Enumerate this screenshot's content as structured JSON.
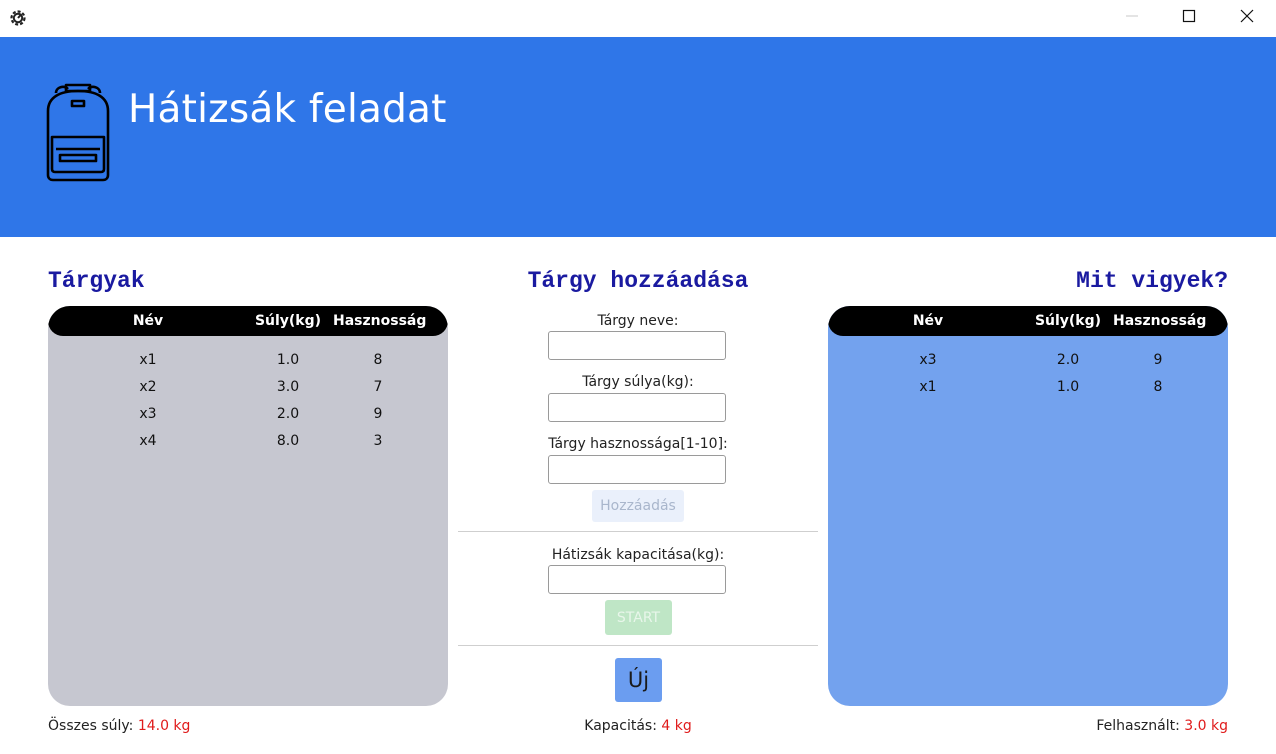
{
  "window": {
    "icons": {
      "app": "gear-icon",
      "minimize": "minimize-icon",
      "maximize": "maximize-icon",
      "close": "close-icon"
    }
  },
  "header": {
    "title": "Hátizsák feladat",
    "icon": "backpack-icon",
    "background": "#2f76e8"
  },
  "items_panel": {
    "title": "Tárgyak",
    "columns": [
      "Név",
      "Súly(kg)",
      "Hasznosság"
    ],
    "rows": [
      {
        "name": "x1",
        "weight": "1.0",
        "value": "8"
      },
      {
        "name": "x2",
        "weight": "3.0",
        "value": "7"
      },
      {
        "name": "x3",
        "weight": "2.0",
        "value": "9"
      },
      {
        "name": "x4",
        "weight": "8.0",
        "value": "3"
      }
    ],
    "background": "#c6c7d0"
  },
  "add_panel": {
    "title": "Tárgy hozzáadása",
    "name_label": "Tárgy neve:",
    "name_value": "",
    "weight_label": "Tárgy súlya(kg):",
    "weight_value": "",
    "value_label": "Tárgy hasznossága[1-10]:",
    "value_value": "",
    "add_button": "Hozzáadás",
    "capacity_label": "Hátizsák kapacitása(kg):",
    "capacity_value": "",
    "start_button": "START",
    "new_button": "Új"
  },
  "result_panel": {
    "title": "Mit vigyek?",
    "columns": [
      "Név",
      "Súly(kg)",
      "Hasznosság"
    ],
    "rows": [
      {
        "name": "x3",
        "weight": "2.0",
        "value": "9"
      },
      {
        "name": "x1",
        "weight": "1.0",
        "value": "8"
      }
    ],
    "background": "#73a2ee"
  },
  "footer": {
    "total_label": "Összes súly:",
    "total_value": "14.0 kg",
    "capacity_label": "Kapacitás:",
    "capacity_value": "4 kg",
    "used_label": "Felhasznált:",
    "used_value": "3.0 kg",
    "value_color": "#e01b1b"
  }
}
